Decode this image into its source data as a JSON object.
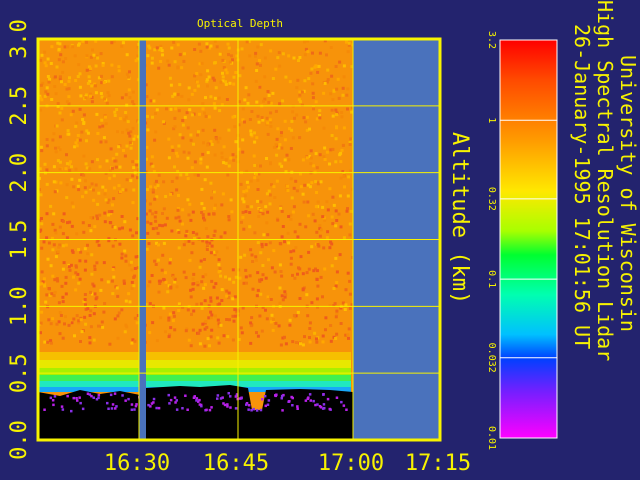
{
  "chart_data": {
    "type": "heatmap",
    "title": "Optical Depth",
    "ylabel": "Altitude (km)",
    "x_ticks": [
      "16:30",
      "16:45",
      "17:00",
      "17:15"
    ],
    "y_ticks": [
      "0.0",
      "0.5",
      "1.0",
      "1.5",
      "2.0",
      "2.5",
      "3.0"
    ],
    "y_range": [
      0.0,
      3.0
    ],
    "colorbar": {
      "ticks": [
        "3.2",
        "1",
        "0.32",
        "0.1",
        "0.032",
        "0.01"
      ],
      "values": [
        3.2,
        1,
        0.32,
        0.1,
        0.032,
        0.01
      ],
      "scale": "log"
    },
    "grid": true,
    "colors": {
      "axis": "#f7f300",
      "background": "#23236e",
      "no_data": "#4a72bc",
      "ground": "#000000"
    }
  },
  "header": {
    "line1": "University of Wisconsin",
    "line2": "High Spectral Resolution Lidar",
    "line3": "26-January-1995 17:01:56 UT"
  }
}
